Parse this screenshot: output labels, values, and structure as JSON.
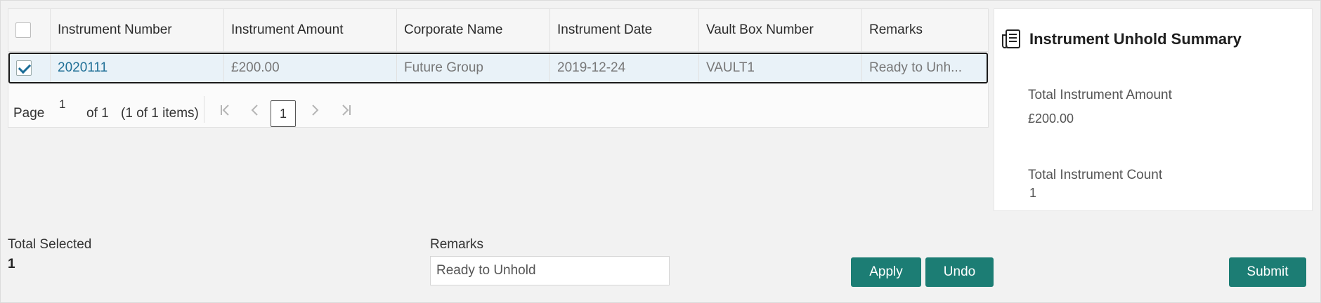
{
  "grid": {
    "columns": [
      "Instrument Number",
      "Instrument Amount",
      "Corporate Name",
      "Instrument Date",
      "Vault Box Number",
      "Remarks"
    ],
    "rows": [
      {
        "selected": true,
        "instrument_number": "2020111",
        "instrument_amount": "£200.00",
        "corporate_name": "Future Group",
        "instrument_date": "2019-12-24",
        "vault_box_number": "VAULT1",
        "remarks": "Ready to Unh..."
      }
    ],
    "pager": {
      "page_label": "Page",
      "current_page": "1",
      "of_label": "of 1",
      "items_label": "(1 of 1 items)",
      "page_box": "1",
      "first_icon": "first-page-icon",
      "prev_icon": "prev-page-icon",
      "next_icon": "next-page-icon",
      "last_icon": "last-page-icon"
    }
  },
  "summary": {
    "title": "Instrument Unhold Summary",
    "icon": "summary-document-icon",
    "total_amount_label": "Total Instrument Amount",
    "total_amount_value": "£200.00",
    "total_count_label": "Total Instrument Count",
    "total_count_value": "1"
  },
  "footer": {
    "total_selected_label": "Total Selected",
    "total_selected_value": "1",
    "remarks_label": "Remarks",
    "remarks_value": "Ready to Unhold",
    "apply_label": "Apply",
    "undo_label": "Undo",
    "submit_label": "Submit"
  },
  "colors": {
    "primary_button": "#1c7d74",
    "link": "#1f6f96",
    "selected_row": "#e9f2f8",
    "background": "#f2f2f2"
  }
}
